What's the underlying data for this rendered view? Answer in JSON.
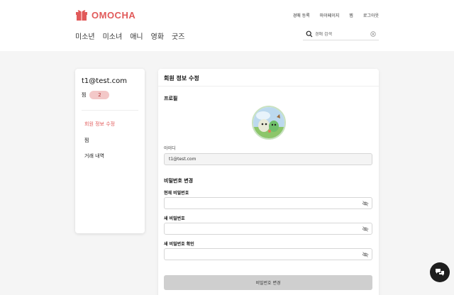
{
  "brand": {
    "name": "OMOCHA",
    "accent": "#e15a5a"
  },
  "top_links": [
    "경매 등록",
    "마이페이지",
    "찜",
    "로그아웃"
  ],
  "nav": [
    "미소년",
    "미소녀",
    "애니",
    "영화",
    "굿즈"
  ],
  "search": {
    "placeholder": "경매 검색",
    "value": ""
  },
  "sidebar": {
    "email": "t1@test.com",
    "favorites_label": "찜",
    "favorites_count": "2",
    "menu": [
      "회원 정보 수정",
      "찜",
      "거래 내역"
    ],
    "active_menu": "회원 정보 수정"
  },
  "main": {
    "title": "회원 정보 수정",
    "profile_title": "프로필",
    "id_label": "아이디",
    "id_value": "t1@test.com",
    "password_section_title": "비밀번호 변경",
    "current_password_label": "현재 비밀번호",
    "new_password_label": "새 비밀번호",
    "confirm_password_label": "새 비밀번호 확인",
    "submit_label": "비밀번호 변경"
  },
  "icons": {
    "logo": "gift-box-icon",
    "search": "search-icon",
    "clear": "clear-circle-icon",
    "eye": "eye-off-icon",
    "chat": "chat-bubbles-icon"
  }
}
